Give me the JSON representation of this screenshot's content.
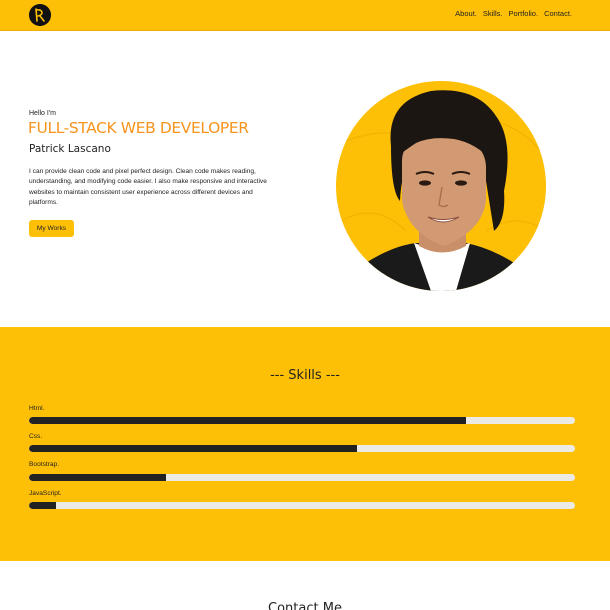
{
  "navbar": {
    "logo_icon": "monogram-logo-icon",
    "links": [
      "About.",
      "Skills.",
      "Portfolio.",
      "Contact."
    ]
  },
  "hero": {
    "greeting": "Hello I'm",
    "headline": "FULL-STACK WEB DEVELOPER",
    "name": "Patrick Lascano",
    "intro": "I can provide clean code and pixel perfect design. Clean code makes reading, understanding, and modifying code easier. I also make responsive and interactive websites to maintain consistent user experience across different devices and platforms.",
    "button_label": "My Works",
    "portrait_icon": "profile-photo"
  },
  "skills": {
    "title": "--- Skills ---",
    "items": [
      {
        "label": "Html.",
        "level": 0.8
      },
      {
        "label": "Css.",
        "level": 0.6
      },
      {
        "label": "Bootstrap.",
        "level": 0.25
      },
      {
        "label": "JavaScript.",
        "level": 0.05
      }
    ]
  },
  "contact": {
    "title": "Contact Me"
  },
  "colors": {
    "accent": "#fec006",
    "headline": "#f7941d",
    "bar_fill": "#222222",
    "bar_track": "#eceae4"
  }
}
